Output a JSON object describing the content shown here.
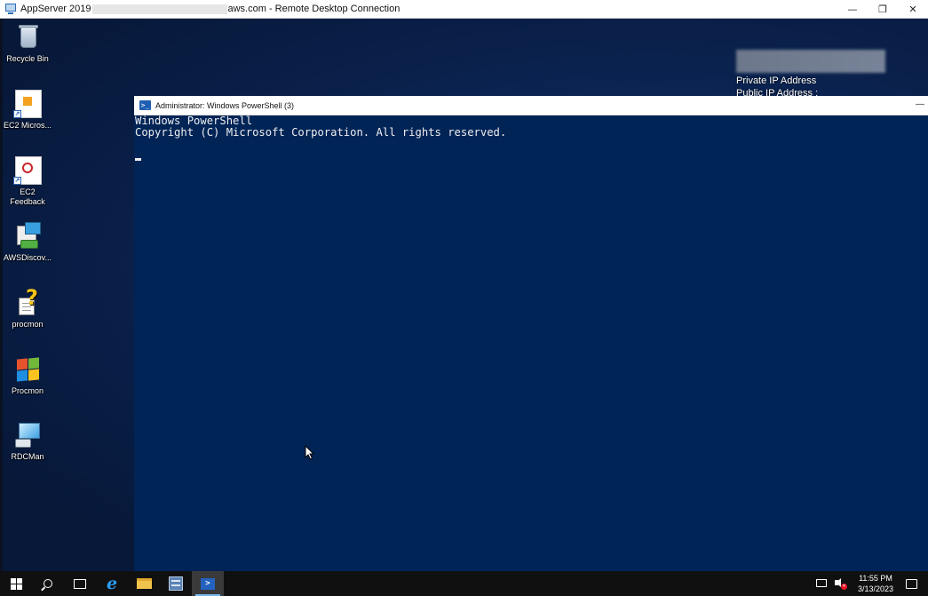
{
  "rdp_window": {
    "title_prefix": "AppServer 2019",
    "title_suffix": "aws.com - Remote Desktop Connection",
    "minimize": "—",
    "restore": "❐",
    "close": "✕"
  },
  "desktop_icons": [
    {
      "name": "recycle-bin",
      "label": "Recycle Bin"
    },
    {
      "name": "ec2-microsoft",
      "label": "EC2 Micros..."
    },
    {
      "name": "ec2-feedback",
      "label": "EC2 Feedback"
    },
    {
      "name": "aws-discovery",
      "label": "AWSDiscov..."
    },
    {
      "name": "procmon-lower",
      "label": "procmon"
    },
    {
      "name": "procmon-upper",
      "label": "Procmon"
    },
    {
      "name": "rdcman",
      "label": "RDCMan"
    }
  ],
  "overlay_info": {
    "private_ip_label": "Private IP Address",
    "public_ip_label": "Public IP Address :"
  },
  "powershell": {
    "title": "Administrator: Windows PowerShell (3)",
    "icon_text": ">_",
    "minimize": "—",
    "lines": [
      "Windows PowerShell",
      "Copyright (C) Microsoft Corporation. All rights reserved."
    ]
  },
  "taskbar": {
    "items": [
      "start-button",
      "search-button",
      "task-view-button",
      "internet-explorer",
      "file-explorer",
      "server-manager",
      "windows-powershell"
    ],
    "active_item": "windows-powershell",
    "ps_icon_text": ">",
    "ie_glyph": "e",
    "mute_glyph": "✕",
    "time": "11:55 PM",
    "date": "3/13/2023"
  },
  "colors": {
    "powershell_bg": "#012456",
    "console_text": "#eeedf0",
    "taskbar_bg": "#101010",
    "taskbar_accent": "#76b9ed"
  }
}
